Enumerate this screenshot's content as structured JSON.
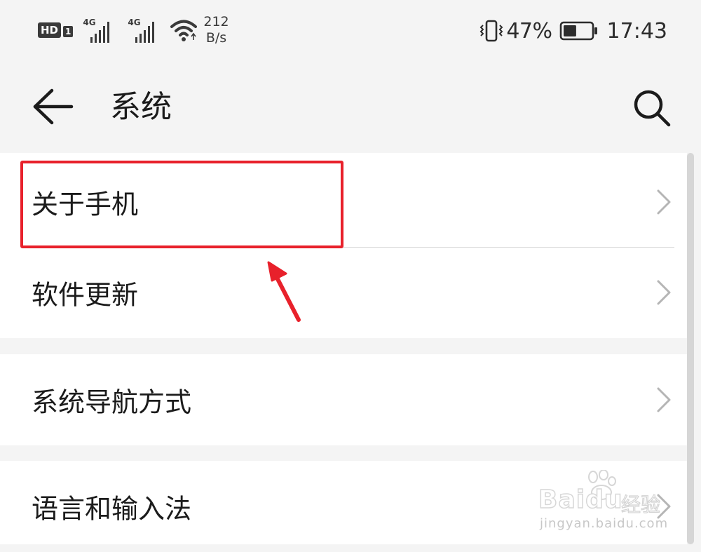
{
  "status_bar": {
    "hd": "HD",
    "hd_sim": "1",
    "network_1": "4G",
    "network_2": "4G",
    "speed_value": "212",
    "speed_unit": "B/s",
    "battery_pct": "47%",
    "battery_level": 0.47,
    "time": "17:43",
    "icons": [
      "hd-icon",
      "signal-icon",
      "signal-icon",
      "wifi-icon",
      "vibrate-icon",
      "battery-icon"
    ]
  },
  "header": {
    "title": "系统",
    "back_icon": "back-arrow-icon",
    "search_icon": "search-icon"
  },
  "settings": {
    "groups": [
      {
        "items": [
          {
            "label": "关于手机"
          },
          {
            "label": "软件更新"
          }
        ]
      },
      {
        "items": [
          {
            "label": "系统导航方式"
          }
        ]
      },
      {
        "items": [
          {
            "label": "语言和输入法"
          }
        ]
      }
    ],
    "chevron_icon": "chevron-right-icon"
  },
  "annotation": {
    "highlight_color": "#e8212b",
    "arrow_color": "#e8212b"
  },
  "watermark": {
    "brand": "Baidu",
    "brand_cn": "经验",
    "url": "jingyan.baidu.com"
  },
  "colors": {
    "background": "#f4f4f4",
    "card": "#ffffff",
    "text": "#1b1b1b",
    "chevron": "#b5b5b5",
    "divider": "#d8d8d8"
  }
}
